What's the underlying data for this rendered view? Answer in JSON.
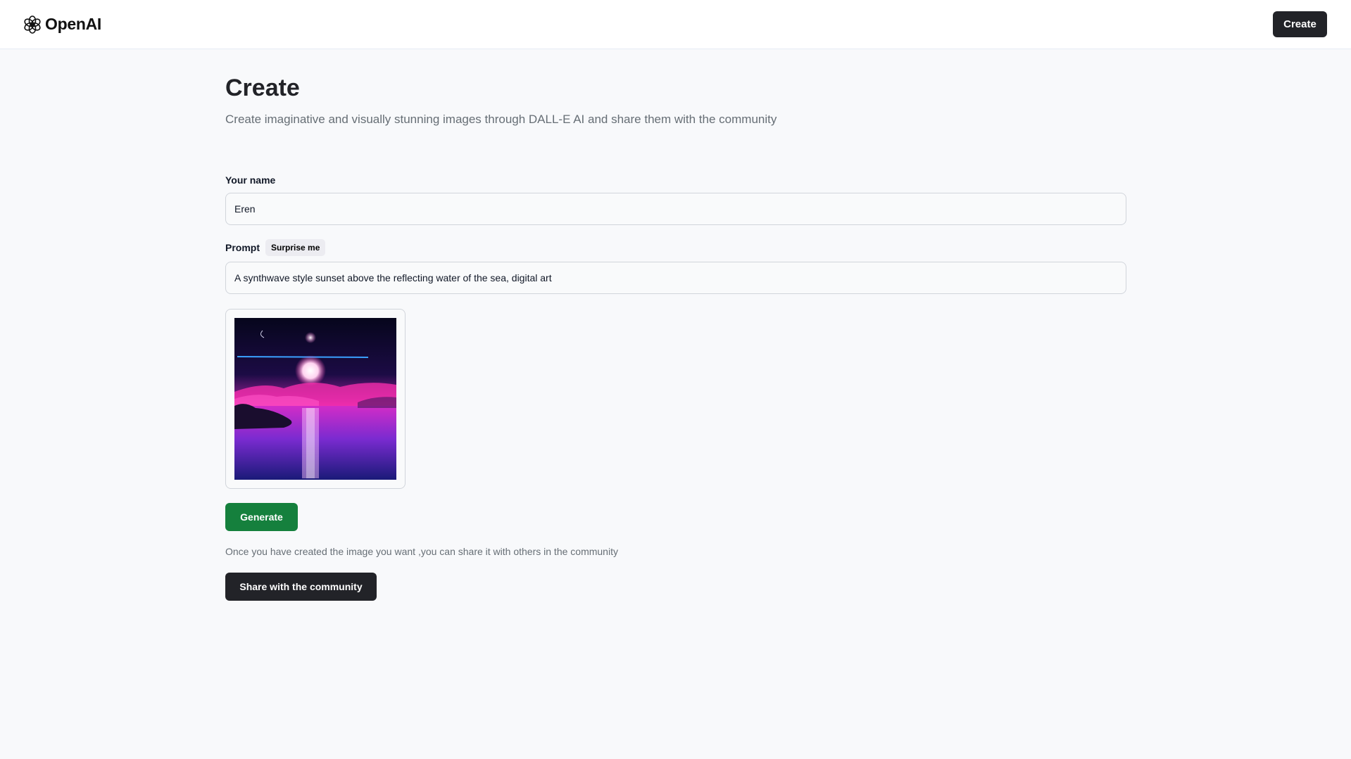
{
  "header": {
    "brand": "OpenAI",
    "create_label": "Create"
  },
  "page": {
    "title": "Create",
    "subtitle": "Create imaginative and visually stunning images through DALL-E AI and share them with the community"
  },
  "form": {
    "name_label": "Your name",
    "name_value": "Eren",
    "prompt_label": "Prompt",
    "surprise_label": "Surprise me",
    "prompt_value": "A synthwave style sunset above the reflecting water of the sea, digital art",
    "generate_label": "Generate",
    "share_text": "Once you have created the image you want ,you can share it with others in the community",
    "share_label": "Share with the community"
  },
  "colors": {
    "primary_dark": "#222328",
    "generate_green": "#15803d",
    "muted_text": "#666e75",
    "page_bg": "#f8f9fb"
  },
  "icons": {
    "brand": "openai-logo-icon"
  }
}
